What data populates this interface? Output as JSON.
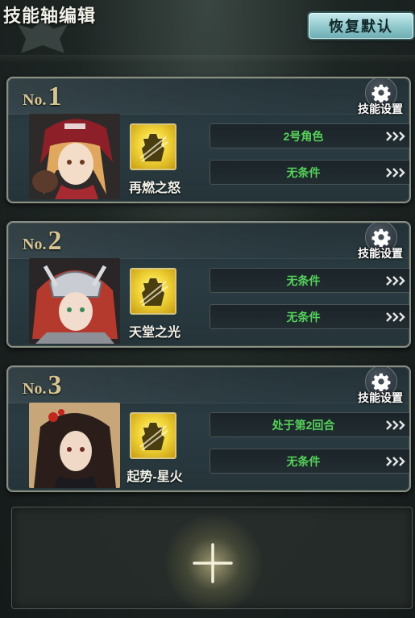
{
  "header": {
    "title": "技能轴编辑",
    "reset_label": "恢复默认"
  },
  "cards": [
    {
      "no_prefix": "No.",
      "no_number": "1",
      "settings_label": "技能设置",
      "skill_name": "再燃之怒",
      "conditions": [
        "2号角色",
        "无条件"
      ]
    },
    {
      "no_prefix": "No.",
      "no_number": "2",
      "settings_label": "技能设置",
      "skill_name": "天堂之光",
      "conditions": [
        "无条件",
        "无条件"
      ]
    },
    {
      "no_prefix": "No.",
      "no_number": "3",
      "settings_label": "技能设置",
      "skill_name": "起势-星火",
      "conditions": [
        "处于第2回合",
        "无条件"
      ]
    }
  ],
  "icons": {
    "settings": "gear-icon",
    "skill": "skill-emblem-icon",
    "expand": "triple-chevron-right-icon",
    "add": "plus-icon"
  },
  "colors": {
    "condition_text": "#55d25a",
    "reset_button": "#9fd4d7",
    "card_number": "#d8c594",
    "skill_icon": "#f2d63a"
  }
}
